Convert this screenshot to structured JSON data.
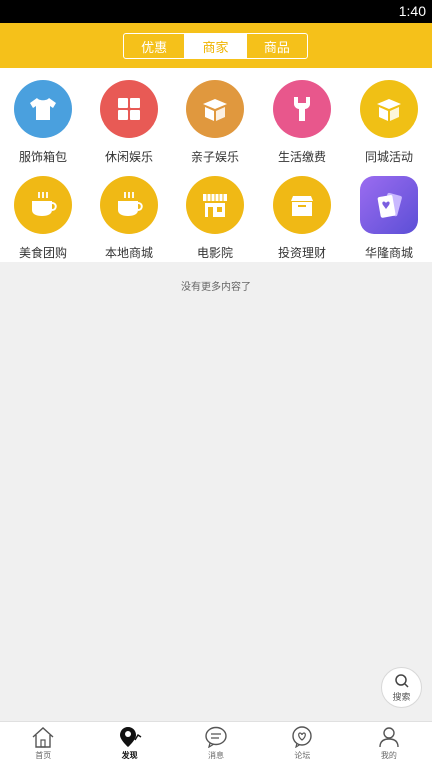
{
  "status_bar": {
    "time": "1:40"
  },
  "header": {
    "tabs": [
      {
        "label": "优惠",
        "active": false
      },
      {
        "label": "商家",
        "active": true
      },
      {
        "label": "商品",
        "active": false
      }
    ]
  },
  "categories": [
    {
      "label": "服饰箱包",
      "icon": "shirt-icon",
      "color": "#4aa0de"
    },
    {
      "label": "休闲娱乐",
      "icon": "grid-icon",
      "color": "#e85a55"
    },
    {
      "label": "亲子娱乐",
      "icon": "box-icon",
      "color": "#e0983e"
    },
    {
      "label": "生活缴费",
      "icon": "wrench-icon",
      "color": "#e8578c"
    },
    {
      "label": "同城活动",
      "icon": "box-icon",
      "color": "#f0c015"
    },
    {
      "label": "美食团购",
      "icon": "coffee-cup-icon",
      "color": "#f0b915"
    },
    {
      "label": "本地商城",
      "icon": "coffee-cup-icon",
      "color": "#f0b915"
    },
    {
      "label": "电影院",
      "icon": "storefront-icon",
      "color": "#f0b915"
    },
    {
      "label": "投资理财",
      "icon": "box-icon",
      "color": "#f0b915"
    },
    {
      "label": "华隆商城",
      "icon": "cards-icon",
      "color": "#7b5fe0"
    }
  ],
  "no_more_text": "没有更多内容了",
  "search_fab": {
    "label": "搜索"
  },
  "tabbar": {
    "items": [
      {
        "label": "首页",
        "icon": "home-icon",
        "active": false
      },
      {
        "label": "发现",
        "icon": "location-pin-icon",
        "active": true
      },
      {
        "label": "消息",
        "icon": "chat-bubble-icon",
        "active": false
      },
      {
        "label": "论坛",
        "icon": "heart-bubble-icon",
        "active": false
      },
      {
        "label": "我的",
        "icon": "person-icon",
        "active": false
      }
    ]
  }
}
